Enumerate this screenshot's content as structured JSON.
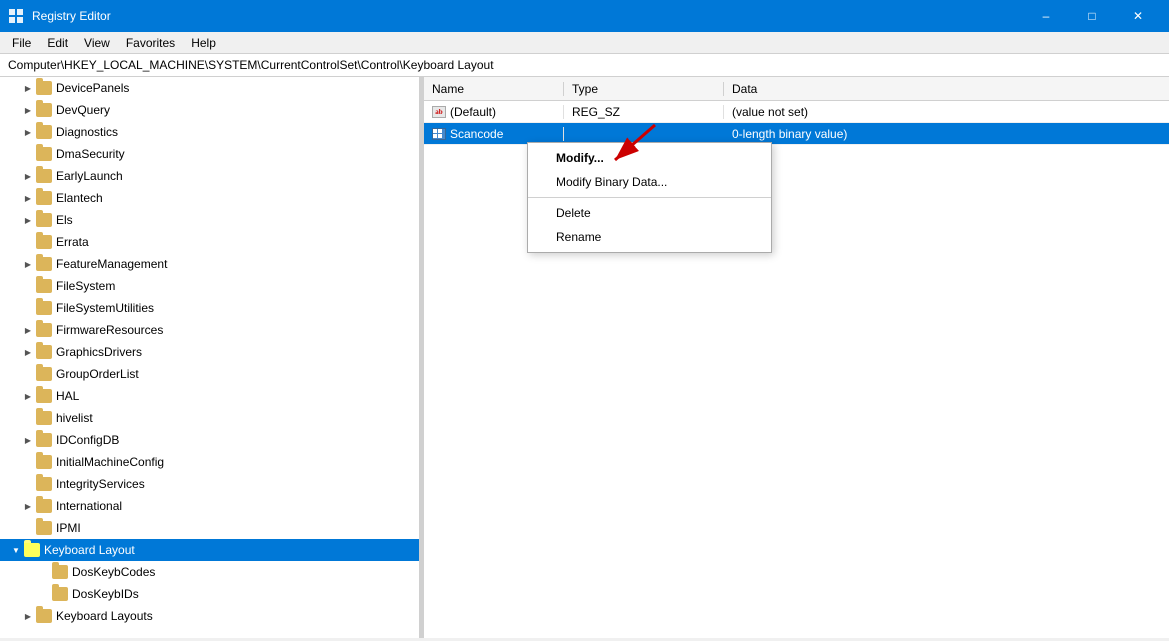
{
  "titleBar": {
    "icon": "⊞",
    "title": "Registry Editor",
    "minimize": "–",
    "maximize": "□",
    "close": "✕"
  },
  "menuBar": {
    "items": [
      "File",
      "Edit",
      "View",
      "Favorites",
      "Help"
    ]
  },
  "addressBar": {
    "path": "Computer\\HKEY_LOCAL_MACHINE\\SYSTEM\\CurrentControlSet\\Control\\Keyboard Layout"
  },
  "treeItems": [
    {
      "id": "DevicePanels",
      "label": "DevicePanels",
      "indent": 1,
      "hasChildren": true,
      "expanded": false
    },
    {
      "id": "DevQuery",
      "label": "DevQuery",
      "indent": 1,
      "hasChildren": true,
      "expanded": false
    },
    {
      "id": "Diagnostics",
      "label": "Diagnostics",
      "indent": 1,
      "hasChildren": true,
      "expanded": false
    },
    {
      "id": "DmaSecurity",
      "label": "DmaSecurity",
      "indent": 1,
      "hasChildren": false,
      "expanded": false
    },
    {
      "id": "EarlyLaunch",
      "label": "EarlyLaunch",
      "indent": 1,
      "hasChildren": true,
      "expanded": false
    },
    {
      "id": "Elantech",
      "label": "Elantech",
      "indent": 1,
      "hasChildren": true,
      "expanded": false
    },
    {
      "id": "Els",
      "label": "Els",
      "indent": 1,
      "hasChildren": true,
      "expanded": false
    },
    {
      "id": "Errata",
      "label": "Errata",
      "indent": 1,
      "hasChildren": false,
      "expanded": false
    },
    {
      "id": "FeatureManagement",
      "label": "FeatureManagement",
      "indent": 1,
      "hasChildren": true,
      "expanded": false
    },
    {
      "id": "FileSystem",
      "label": "FileSystem",
      "indent": 1,
      "hasChildren": false,
      "expanded": false
    },
    {
      "id": "FileSystemUtilities",
      "label": "FileSystemUtilities",
      "indent": 1,
      "hasChildren": false,
      "expanded": false
    },
    {
      "id": "FirmwareResources",
      "label": "FirmwareResources",
      "indent": 1,
      "hasChildren": true,
      "expanded": false
    },
    {
      "id": "GraphicsDrivers",
      "label": "GraphicsDrivers",
      "indent": 1,
      "hasChildren": true,
      "expanded": false
    },
    {
      "id": "GroupOrderList",
      "label": "GroupOrderList",
      "indent": 1,
      "hasChildren": false,
      "expanded": false
    },
    {
      "id": "HAL",
      "label": "HAL",
      "indent": 1,
      "hasChildren": true,
      "expanded": false
    },
    {
      "id": "hivelist",
      "label": "hivelist",
      "indent": 1,
      "hasChildren": false,
      "expanded": false
    },
    {
      "id": "IDConfigDB",
      "label": "IDConfigDB",
      "indent": 1,
      "hasChildren": true,
      "expanded": false
    },
    {
      "id": "InitialMachineConfig",
      "label": "InitialMachineConfig",
      "indent": 1,
      "hasChildren": false,
      "expanded": false
    },
    {
      "id": "IntegrityServices",
      "label": "IntegrityServices",
      "indent": 1,
      "hasChildren": false,
      "expanded": false
    },
    {
      "id": "International",
      "label": "International",
      "indent": 1,
      "hasChildren": true,
      "expanded": false
    },
    {
      "id": "IPMI",
      "label": "IPMI",
      "indent": 1,
      "hasChildren": false,
      "expanded": false
    },
    {
      "id": "KeyboardLayout",
      "label": "Keyboard Layout",
      "indent": 1,
      "hasChildren": true,
      "expanded": true,
      "selected": true
    },
    {
      "id": "DosKeybCodes",
      "label": "DosKeybCodes",
      "indent": 2,
      "hasChildren": false,
      "expanded": false
    },
    {
      "id": "DosKeybIDs",
      "label": "DosKeybIDs",
      "indent": 2,
      "hasChildren": false,
      "expanded": false
    },
    {
      "id": "KeyboardLayouts",
      "label": "Keyboard Layouts",
      "indent": 1,
      "hasChildren": true,
      "expanded": false
    }
  ],
  "detailColumns": {
    "name": "Name",
    "type": "Type",
    "data": "Data"
  },
  "detailRows": [
    {
      "id": "default",
      "name": "(Default)",
      "iconType": "string",
      "type": "REG_SZ",
      "data": "(value not set)",
      "selected": false
    },
    {
      "id": "scancode",
      "name": "Scancode",
      "iconType": "binary",
      "type": "",
      "data": "0-length binary value)",
      "selected": true
    }
  ],
  "contextMenu": {
    "items": [
      {
        "id": "modify",
        "label": "Modify...",
        "bold": true
      },
      {
        "id": "modify-binary",
        "label": "Modify Binary Data..."
      },
      {
        "id": "sep1",
        "type": "separator"
      },
      {
        "id": "delete",
        "label": "Delete"
      },
      {
        "id": "rename",
        "label": "Rename"
      }
    ]
  }
}
